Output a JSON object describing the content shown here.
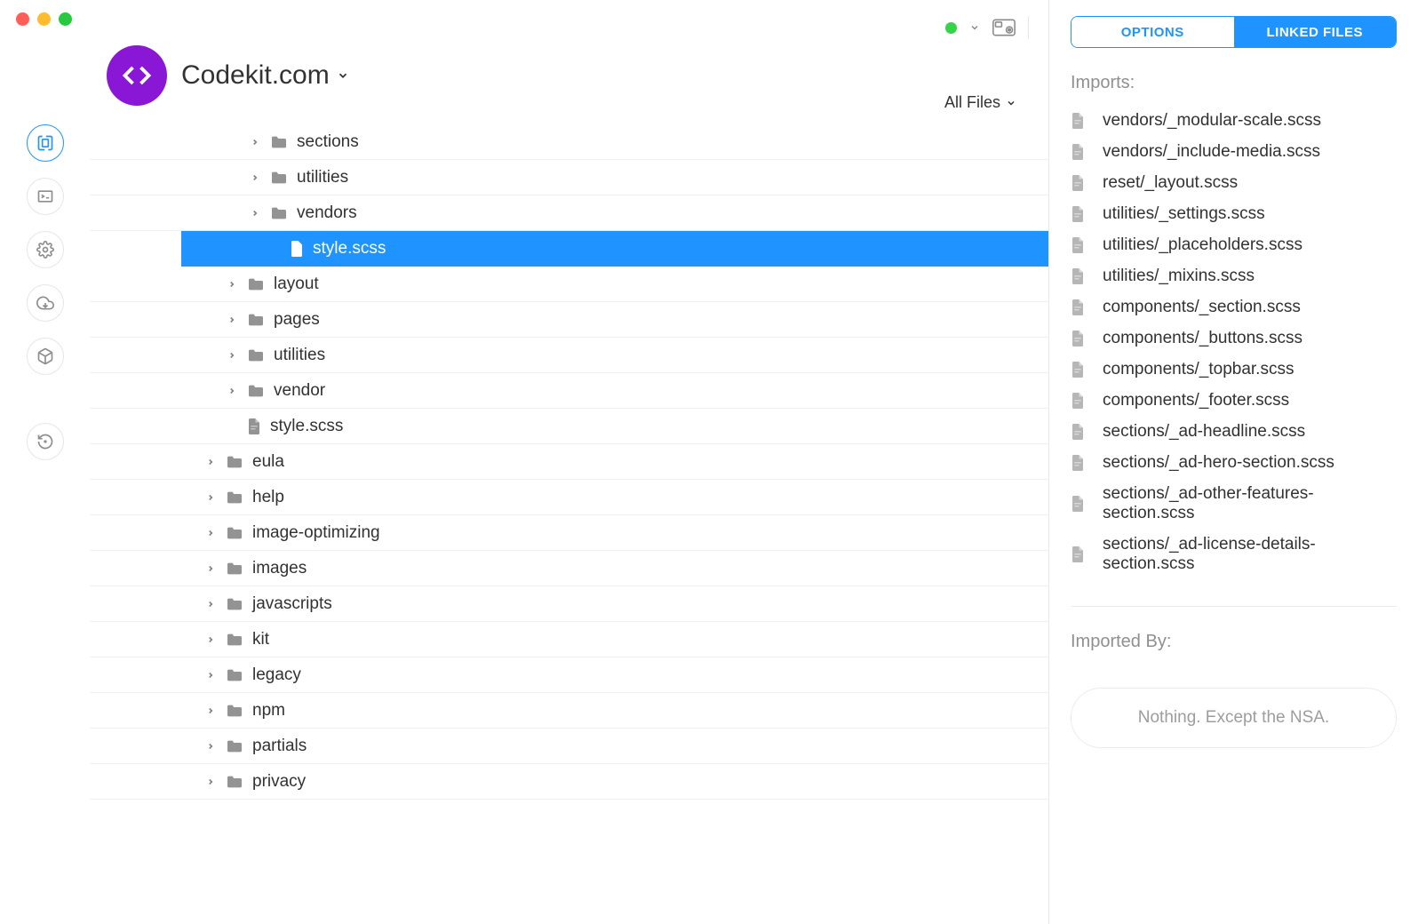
{
  "app": {
    "project_name": "Codekit.com",
    "filter_label": "All Files"
  },
  "sidebar_icons": [
    "files",
    "terminal",
    "settings",
    "cloud",
    "package",
    "history"
  ],
  "tree": [
    {
      "label": "sections",
      "indent": 2,
      "type": "folder",
      "chevron": true
    },
    {
      "label": "utilities",
      "indent": 2,
      "type": "folder",
      "chevron": true
    },
    {
      "label": "vendors",
      "indent": 2,
      "type": "folder",
      "chevron": true
    },
    {
      "label": "style.scss",
      "indent": 2,
      "type": "file",
      "chevron": false,
      "selected": true
    },
    {
      "label": "layout",
      "indent": 1,
      "type": "folder",
      "chevron": true
    },
    {
      "label": "pages",
      "indent": 1,
      "type": "folder",
      "chevron": true
    },
    {
      "label": "utilities",
      "indent": 1,
      "type": "folder",
      "chevron": true
    },
    {
      "label": "vendor",
      "indent": 1,
      "type": "folder",
      "chevron": true
    },
    {
      "label": "style.scss",
      "indent": 1,
      "type": "file",
      "chevron": false
    },
    {
      "label": "eula",
      "indent": 0,
      "type": "folder",
      "chevron": true
    },
    {
      "label": "help",
      "indent": 0,
      "type": "folder",
      "chevron": true
    },
    {
      "label": "image-optimizing",
      "indent": 0,
      "type": "folder",
      "chevron": true
    },
    {
      "label": "images",
      "indent": 0,
      "type": "folder",
      "chevron": true
    },
    {
      "label": "javascripts",
      "indent": 0,
      "type": "folder",
      "chevron": true
    },
    {
      "label": "kit",
      "indent": 0,
      "type": "folder",
      "chevron": true
    },
    {
      "label": "legacy",
      "indent": 0,
      "type": "folder",
      "chevron": true
    },
    {
      "label": "npm",
      "indent": 0,
      "type": "folder",
      "chevron": true
    },
    {
      "label": "partials",
      "indent": 0,
      "type": "folder",
      "chevron": true
    },
    {
      "label": "privacy",
      "indent": 0,
      "type": "folder",
      "chevron": true
    }
  ],
  "panel": {
    "tabs": {
      "options": "OPTIONS",
      "linked": "LINKED FILES"
    },
    "imports_label": "Imports:",
    "imported_by_label": "Imported By:",
    "empty_text": "Nothing. Except the NSA.",
    "imports": [
      "vendors/_modular-scale.scss",
      "vendors/_include-media.scss",
      "reset/_layout.scss",
      "utilities/_settings.scss",
      "utilities/_placeholders.scss",
      "utilities/_mixins.scss",
      "components/_section.scss",
      "components/_buttons.scss",
      "components/_topbar.scss",
      "components/_footer.scss",
      "sections/_ad-headline.scss",
      "sections/_ad-hero-section.scss",
      "sections/_ad-other-features-section.scss",
      "sections/_ad-license-details-section.scss"
    ]
  }
}
